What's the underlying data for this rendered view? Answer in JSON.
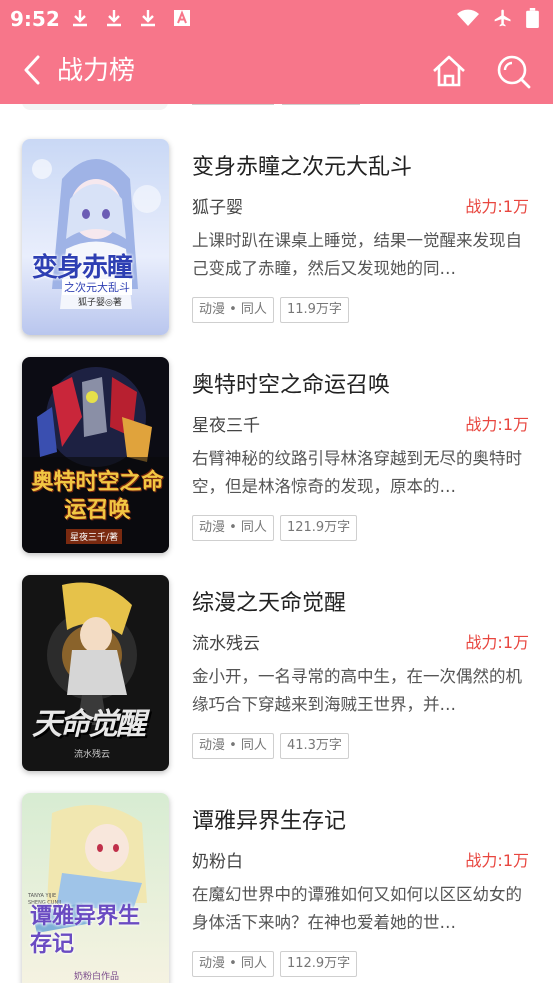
{
  "status": {
    "time": "9:52",
    "left_icons": [
      "download-icon",
      "download-icon",
      "download-icon",
      "font-a-icon"
    ],
    "right_icons": [
      "wifi-icon",
      "airplane-icon",
      "battery-icon"
    ]
  },
  "header": {
    "title": "战力榜",
    "bg_color": "#f7768a"
  },
  "books": [
    {
      "title": "变身赤瞳之次元大乱斗",
      "author": "狐子婴",
      "power": "战力:1万",
      "desc": "上课时趴在课桌上睡觉，结果一觉醒来发现自己变成了赤瞳，然后又发现她的同…",
      "tags": [
        "动漫 • 同人",
        "11.9万字"
      ],
      "cover_title": "变身赤瞳",
      "cover_sub": "之次元大乱斗",
      "cover_author": "狐子婴◎著"
    },
    {
      "title": "奥特时空之命运召唤",
      "author": "星夜三千",
      "power": "战力:1万",
      "desc": "右臂神秘的纹路引导林洛穿越到无尽的奥特时空，但是林洛惊奇的发现，原本的…",
      "tags": [
        "动漫 • 同人",
        "121.9万字"
      ],
      "cover_title": "奥特时空之命运召唤",
      "cover_author": "星夜三千/著"
    },
    {
      "title": "综漫之天命觉醒",
      "author": "流水残云",
      "power": "战力:1万",
      "desc": "金小开，一名寻常的高中生，在一次偶然的机缘巧合下穿越来到海贼王世界，并…",
      "tags": [
        "动漫 • 同人",
        "41.3万字"
      ],
      "cover_title": "天命觉醒",
      "cover_author": "流水残云"
    },
    {
      "title": "谭雅异界生存记",
      "author": "奶粉白",
      "power": "战力:1万",
      "desc": "在魔幻世界中的谭雅如何又如何以区区幼女的身体活下来呐？在神也爱着她的世…",
      "tags": [
        "动漫 • 同人",
        "112.9万字"
      ],
      "cover_title": "谭雅异界生存记",
      "cover_sub": "TANYA YIJIE SHENG CUNJI",
      "cover_author": "奶粉白作品"
    }
  ]
}
